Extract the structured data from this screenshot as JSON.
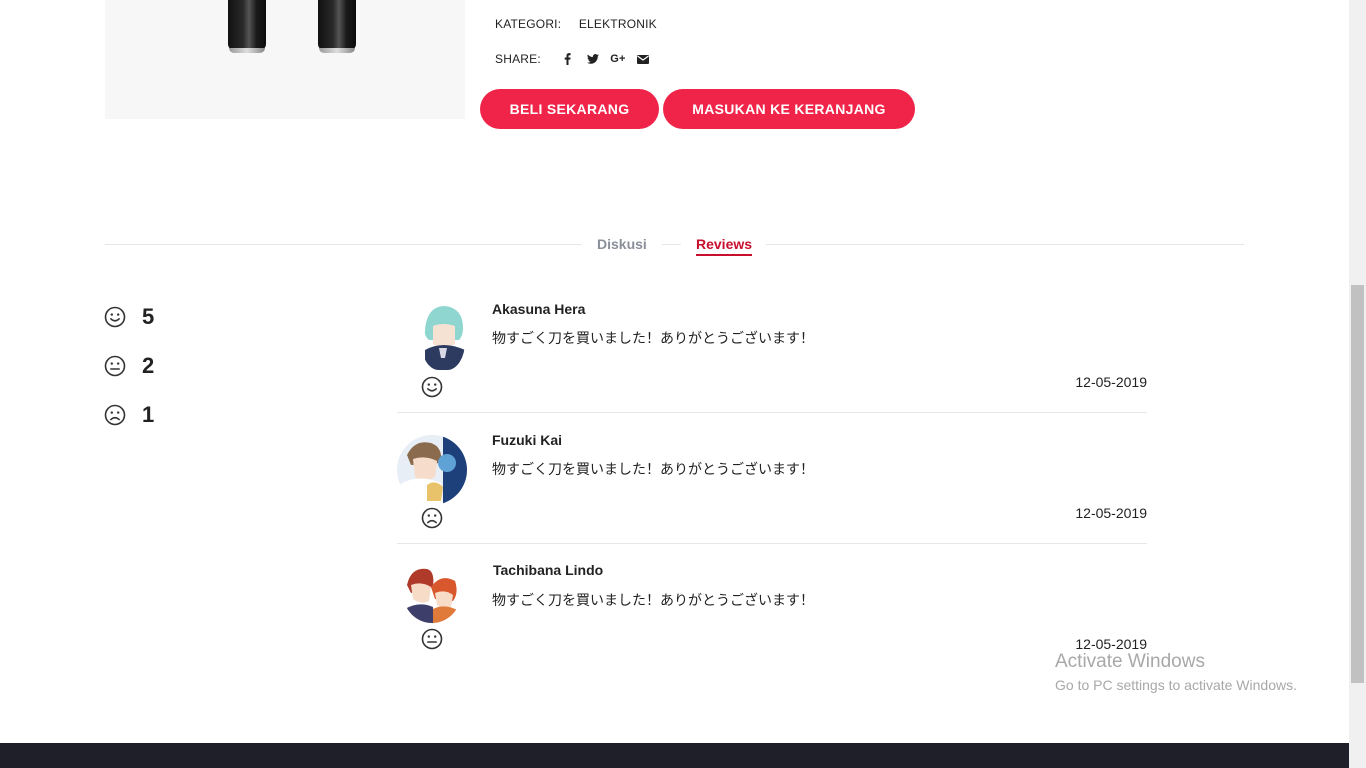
{
  "product": {
    "category_label": "KATEGORI:",
    "category_value": "ELEKTRONIK",
    "share_label": "SHARE:",
    "share_icons": [
      "facebook-icon",
      "twitter-icon",
      "google-plus-icon",
      "email-icon"
    ],
    "google_plus_text": "G+"
  },
  "actions": {
    "buy_label": "BELI SEKARANG",
    "cart_label": "MASUKAN KE KERANJANG"
  },
  "tabs": [
    {
      "label": "Diskusi",
      "active": false
    },
    {
      "label": "Reviews",
      "active": true
    }
  ],
  "summary": [
    {
      "mood": "happy",
      "count": "5"
    },
    {
      "mood": "neutral",
      "count": "2"
    },
    {
      "mood": "sad",
      "count": "1"
    }
  ],
  "reviews": [
    {
      "name": "Akasuna Hera",
      "text": "物すごく刀を買いました！ありがとうございます！",
      "date": "12-05-2019",
      "mood": "happy"
    },
    {
      "name": "Fuzuki Kai",
      "text": "物すごく刀を買いました！ありがとうございます！",
      "date": "12-05-2019",
      "mood": "sad"
    },
    {
      "name": "Tachibana Lindo",
      "text": "物すごく刀を買いました！ありがとうございます！",
      "date": "12-05-2019",
      "mood": "neutral"
    }
  ],
  "colors": {
    "accent": "#f02449",
    "active_tab": "#c8102e",
    "footer": "#1f1f29"
  },
  "watermark": {
    "title": "Activate Windows",
    "subtitle": "Go to PC settings to activate Windows."
  }
}
